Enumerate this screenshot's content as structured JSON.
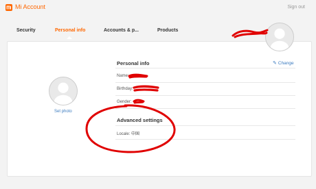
{
  "header": {
    "brand": "Mi Account",
    "sign_out": "Sign out"
  },
  "nav": {
    "tabs": [
      {
        "label": "Security"
      },
      {
        "label": "Personal info"
      },
      {
        "label": "Accounts & p..."
      },
      {
        "label": "Products"
      }
    ]
  },
  "profile": {
    "set_photo": "Set photo"
  },
  "personal_info": {
    "title": "Personal info",
    "change_label": "Change",
    "fields": [
      {
        "label": "Name:"
      },
      {
        "label": "Birthday:"
      },
      {
        "label": "Gender:"
      }
    ]
  },
  "advanced": {
    "title": "Advanced settings",
    "locale_label": "Locale:",
    "locale_value": "中国"
  },
  "colors": {
    "accent": "#ff6700",
    "link": "#3b7bbf",
    "annotation": "#e00000"
  }
}
